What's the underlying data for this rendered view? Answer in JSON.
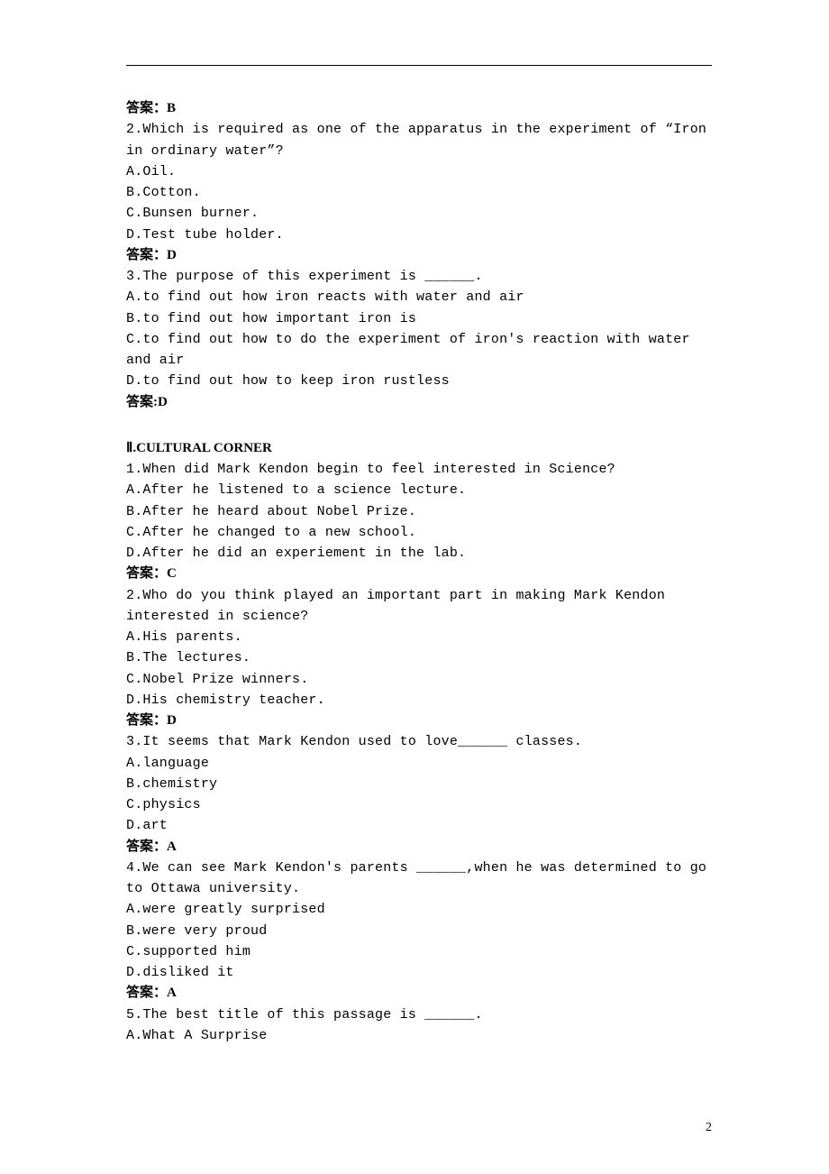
{
  "q2": {
    "answer_label": "答案：B",
    "stem": "2.Which is required as one of the apparatus in the experiment of “Iron in ordinary water”?",
    "a": "A.Oil.",
    "b": "B.Cotton.",
    "c": "C.Bunsen burner.",
    "d": "D.Test tube holder.",
    "answer": "答案：D"
  },
  "q3": {
    "stem": "3.The purpose of this experiment is ______.",
    "a": "A.to find out how iron reacts with water and air",
    "b": "B.to find out how important iron is",
    "c": "C.to find out how to do the experiment of iron's reaction with water and air",
    "d": "D.to find out how to keep iron rustless",
    "answer": "答案:D"
  },
  "section2": {
    "title": "Ⅱ.CULTURAL CORNER",
    "q1": {
      "stem": "1.When did Mark Kendon begin to feel interested in Science?",
      "a": "A.After he listened to a science lecture.",
      "b": "B.After he heard about Nobel Prize.",
      "c": "C.After he changed to a new school.",
      "d": "D.After he did an experiement in the lab.",
      "answer": "答案：C"
    },
    "q2": {
      "stem": "2.Who do you think played an important part in making Mark Kendon interested in science?",
      "a": "A.His parents.",
      "b": "B.The lectures.",
      "c": "C.Nobel Prize winners.",
      "d": "D.His chemistry teacher.",
      "answer": "答案：D"
    },
    "q3": {
      "stem": "3.It seems that Mark Kendon used to love______ classes.",
      "a": "A.language",
      "b": "B.chemistry",
      "c": "C.physics",
      "d": "D.art",
      "answer": "答案：A"
    },
    "q4": {
      "stem": "4.We can see Mark Kendon's parents ______,when he was determined to go to Ottawa university.",
      "a": "A.were greatly surprised",
      "b": "B.were very proud",
      "c": "C.supported him",
      "d": "D.disliked it",
      "answer": "答案：A"
    },
    "q5": {
      "stem": "5.The best title of this passage is ______.",
      "a": "A.What A Surprise"
    }
  },
  "page_number": "2"
}
